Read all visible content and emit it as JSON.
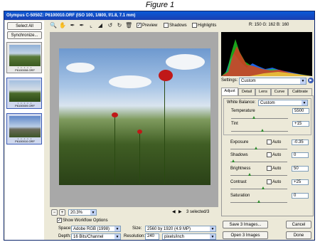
{
  "caption": "Figure 1",
  "window": {
    "title": "Olympus C-5050Z:  P6100010.ORF  (ISO 100, 1/800, f/1.8, 7.1 mm)"
  },
  "filmstrip": {
    "select_all": "Select All",
    "synchronize": "Synchronize...",
    "thumbnails": [
      {
        "label": "P6100008.ORF",
        "stars": "• • • • •",
        "selected": false
      },
      {
        "label": "P6100009.ORF",
        "stars": "• • • • •",
        "selected": true
      },
      {
        "label": "P6100010.ORF",
        "stars": "• • • • •",
        "selected": true
      }
    ]
  },
  "toolbar": {
    "tools": [
      "zoom-icon",
      "hand-icon",
      "eyedropper-icon",
      "color-sampler-icon",
      "crop-icon",
      "straighten-icon",
      "rotate-ccw-icon",
      "rotate-cw-icon",
      "trash-icon"
    ],
    "preview_label": "Preview",
    "preview_checked": true,
    "shadows_label": "Shadows",
    "shadows_checked": false,
    "highlights_label": "Highlights",
    "highlights_checked": false,
    "rgb_readout": "R: 150   G: 162   B: 160"
  },
  "canvas": {
    "zoom": "20.3%",
    "selection_status": "3 selected/3"
  },
  "settings": {
    "label": "Settings:",
    "value": "Custom"
  },
  "tabs": [
    "Adjust",
    "Detail",
    "Lens",
    "Curve",
    "Calibrate"
  ],
  "adjust": {
    "white_balance_label": "White Balance:",
    "white_balance_value": "Custom",
    "temperature": {
      "label": "Temperature",
      "value": "5500",
      "pos": 0.4
    },
    "tint": {
      "label": "Tint",
      "value": "+15",
      "pos": 0.55
    },
    "exposure": {
      "label": "Exposure",
      "value": "-0.35",
      "pos": 0.45,
      "auto": "Auto"
    },
    "shadows": {
      "label": "Shadows",
      "value": "0",
      "pos": 0.02,
      "auto": "Auto"
    },
    "brightness": {
      "label": "Brightness",
      "value": "50",
      "pos": 0.33,
      "auto": "Auto"
    },
    "contrast": {
      "label": "Contrast",
      "value": "+25",
      "pos": 0.58,
      "auto": "Auto"
    },
    "saturation": {
      "label": "Saturation",
      "value": "0",
      "pos": 0.5
    }
  },
  "workflow": {
    "toggle_label": "Show Workflow Options",
    "space_label": "Space:",
    "space_value": "Adobe RGB (1998)",
    "depth_label": "Depth:",
    "depth_value": "16 Bits/Channel",
    "size_label": "Size:",
    "size_value": "2560 by 1920  (4.9 MP)",
    "resolution_label": "Resolution:",
    "resolution_value": "240",
    "resolution_unit": "pixels/inch"
  },
  "buttons": {
    "save": "Save 3 Images...",
    "cancel": "Cancel",
    "open": "Open 3 Images",
    "done": "Done"
  }
}
